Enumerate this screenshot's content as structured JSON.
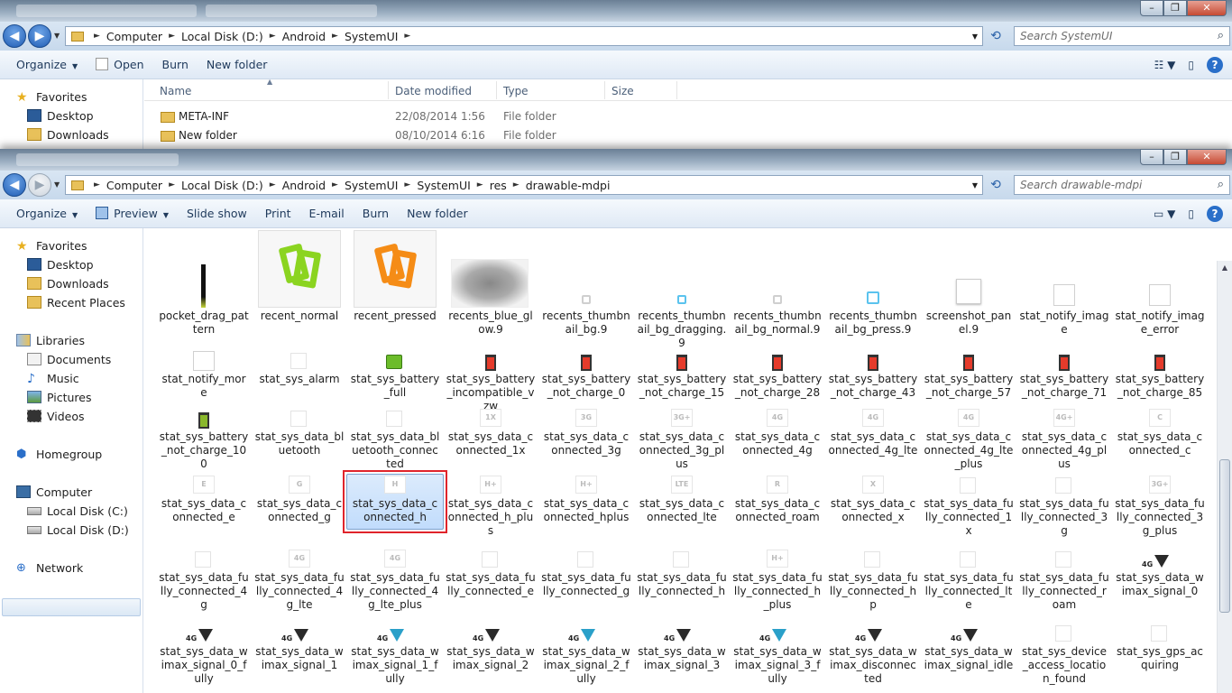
{
  "window1": {
    "path": [
      "Computer",
      "Local Disk (D:)",
      "Android",
      "SystemUI"
    ],
    "search_placeholder": "Search SystemUI",
    "toolbar": [
      "Organize",
      "Open",
      "Burn",
      "New folder"
    ],
    "columns": [
      "Name",
      "Date modified",
      "Type",
      "Size"
    ],
    "rows": [
      {
        "name": "META-INF",
        "date": "22/08/2014 1:56",
        "type": "File folder"
      },
      {
        "name": "New folder",
        "date": "08/10/2014 6:16",
        "type": "File folder"
      }
    ],
    "nav": [
      "Favorites",
      "Desktop",
      "Downloads"
    ]
  },
  "window2": {
    "path": [
      "Computer",
      "Local Disk (D:)",
      "Android",
      "SystemUI",
      "SystemUI",
      "res",
      "drawable-mdpi"
    ],
    "search_placeholder": "Search drawable-mdpi",
    "toolbar": [
      "Organize",
      "Preview",
      "Slide show",
      "Print",
      "E-mail",
      "Burn",
      "New folder"
    ],
    "nav": {
      "favorites": "Favorites",
      "desktop": "Desktop",
      "downloads": "Downloads",
      "recent": "Recent Places",
      "libraries": "Libraries",
      "documents": "Documents",
      "music": "Music",
      "pictures": "Pictures",
      "videos": "Videos",
      "homegroup": "Homegroup",
      "computer": "Computer",
      "localc": "Local Disk (C:)",
      "locald": "Local Disk (D:)",
      "network": "Network"
    },
    "selected_file": "stat_sys_data_connected_h",
    "files": [
      [
        "pocket_drag_pattern",
        "recent_normal",
        "recent_pressed",
        "recents_blue_glow.9",
        "recents_thumbnail_bg.9",
        "recents_thumbnail_bg_dragging.9",
        "recents_thumbnail_bg_normal.9",
        "recents_thumbnail_bg_press.9",
        "screenshot_panel.9",
        "stat_notify_image",
        "stat_notify_image_error"
      ],
      [
        "stat_notify_more",
        "stat_sys_alarm",
        "stat_sys_battery_full",
        "stat_sys_battery_incompatible_vzw",
        "stat_sys_battery_not_charge_0",
        "stat_sys_battery_not_charge_15",
        "stat_sys_battery_not_charge_28",
        "stat_sys_battery_not_charge_43",
        "stat_sys_battery_not_charge_57",
        "stat_sys_battery_not_charge_71",
        "stat_sys_battery_not_charge_85"
      ],
      [
        "stat_sys_battery_not_charge_100",
        "stat_sys_data_bluetooth",
        "stat_sys_data_bluetooth_connected",
        "stat_sys_data_connected_1x",
        "stat_sys_data_connected_3g",
        "stat_sys_data_connected_3g_plus",
        "stat_sys_data_connected_4g",
        "stat_sys_data_connected_4g_lte",
        "stat_sys_data_connected_4g_lte_plus",
        "stat_sys_data_connected_4g_plus",
        "stat_sys_data_connected_c"
      ],
      [
        "stat_sys_data_connected_e",
        "stat_sys_data_connected_g",
        "stat_sys_data_connected_h",
        "stat_sys_data_connected_h_plus",
        "stat_sys_data_connected_hplus",
        "stat_sys_data_connected_lte",
        "stat_sys_data_connected_roam",
        "stat_sys_data_connected_x",
        "stat_sys_data_fully_connected_1x",
        "stat_sys_data_fully_connected_3g",
        "stat_sys_data_fully_connected_3g_plus"
      ],
      [
        "stat_sys_data_fully_connected_4g",
        "stat_sys_data_fully_connected_4g_lte",
        "stat_sys_data_fully_connected_4g_lte_plus",
        "stat_sys_data_fully_connected_e",
        "stat_sys_data_fully_connected_g",
        "stat_sys_data_fully_connected_h",
        "stat_sys_data_fully_connected_h_plus",
        "stat_sys_data_fully_connected_hp",
        "stat_sys_data_fully_connected_lte",
        "stat_sys_data_fully_connected_roam",
        "stat_sys_data_wimax_signal_0"
      ],
      [
        "stat_sys_data_wimax_signal_0_fully",
        "stat_sys_data_wimax_signal_1",
        "stat_sys_data_wimax_signal_1_fully",
        "stat_sys_data_wimax_signal_2",
        "stat_sys_data_wimax_signal_2_fully",
        "stat_sys_data_wimax_signal_3",
        "stat_sys_data_wimax_signal_3_fully",
        "stat_sys_data_wimax_disconnected",
        "stat_sys_data_wimax_signal_idle",
        "stat_sys_device_access_location_found",
        "stat_sys_gps_acquiring"
      ]
    ],
    "thumb_text": {
      "stat_sys_data_connected_1x": "1X",
      "stat_sys_data_connected_3g": "3G",
      "stat_sys_data_connected_3g_plus": "3G+",
      "stat_sys_data_connected_4g": "4G",
      "stat_sys_data_connected_4g_lte": "4G",
      "stat_sys_data_connected_4g_lte_plus": "4G",
      "stat_sys_data_connected_4g_plus": "4G+",
      "stat_sys_data_connected_c": "C",
      "stat_sys_data_connected_e": "E",
      "stat_sys_data_connected_g": "G",
      "stat_sys_data_connected_h": "H",
      "stat_sys_data_connected_h_plus": "H+",
      "stat_sys_data_connected_hplus": "H+",
      "stat_sys_data_connected_lte": "LTE",
      "stat_sys_data_connected_roam": "R",
      "stat_sys_data_connected_x": "X",
      "stat_sys_data_fully_connected_3g_plus": "3G+",
      "stat_sys_data_fully_connected_4g_lte": "4G",
      "stat_sys_data_fully_connected_4g_lte_plus": "4G",
      "stat_sys_data_fully_connected_h_plus": "H+",
      "stat_sys_data_wimax_signal_0": "4G",
      "stat_sys_data_wimax_signal_0_fully": "4G",
      "stat_sys_data_wimax_signal_1": "4G",
      "stat_sys_data_wimax_signal_1_fully": "4G",
      "stat_sys_data_wimax_signal_2": "4G",
      "stat_sys_data_wimax_signal_2_fully": "4G",
      "stat_sys_data_wimax_signal_3": "4G",
      "stat_sys_data_wimax_signal_3_fully": "4G",
      "stat_sys_data_wimax_disconnected": "4G",
      "stat_sys_data_wimax_signal_idle": "4G"
    }
  },
  "colors": {
    "accent": "#3399ff",
    "selection_border": "#7da2ce",
    "highlight": "#e0242b",
    "recent_normal": "#8bd420",
    "recent_pressed": "#f58c16"
  }
}
